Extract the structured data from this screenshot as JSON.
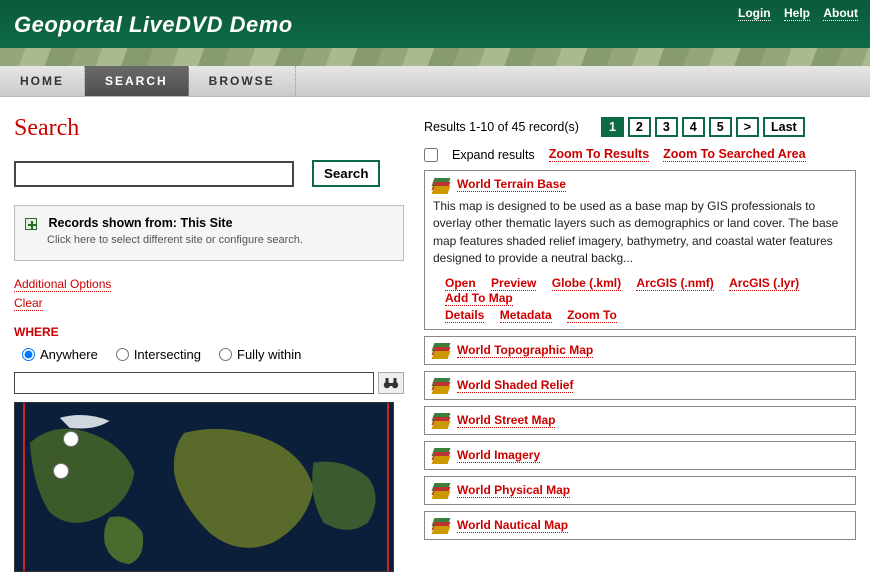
{
  "header": {
    "title": "Geoportal LiveDVD Demo",
    "links": {
      "login": "Login",
      "help": "Help",
      "about": "About"
    }
  },
  "nav": {
    "home": "HOME",
    "search": "SEARCH",
    "browse": "BROWSE"
  },
  "page_title": "Search",
  "search": {
    "button": "Search",
    "value": ""
  },
  "records_panel": {
    "title": "Records shown from: This Site",
    "subtitle": "Click here to select different site or configure search."
  },
  "options": {
    "additional": "Additional Options",
    "clear": "Clear",
    "where": "WHERE"
  },
  "radios": {
    "anywhere": "Anywhere",
    "intersecting": "Intersecting",
    "fully_within": "Fully within"
  },
  "locate": {
    "value": ""
  },
  "results_summary": "Results 1-10 of 45 record(s)",
  "pager": {
    "p1": "1",
    "p2": "2",
    "p3": "3",
    "p4": "4",
    "p5": "5",
    "next": ">",
    "last": "Last"
  },
  "expand": {
    "label": "Expand results",
    "zoom_results": "Zoom To Results",
    "zoom_searched": "Zoom To Searched Area"
  },
  "feature": {
    "title": "World Terrain Base",
    "desc": "This map is designed to be used as a base map by GIS professionals to overlay other thematic layers such as demographics or land cover. The base map features shaded relief imagery, bathymetry, and coastal water features designed to provide a neutral backg...",
    "actions": {
      "open": "Open",
      "preview": "Preview",
      "globe": "Globe (.kml)",
      "nmf": "ArcGIS (.nmf)",
      "lyr": "ArcGIS (.lyr)",
      "addmap": "Add To Map",
      "details": "Details",
      "metadata": "Metadata",
      "zoom": "Zoom To"
    }
  },
  "items": [
    {
      "title": "World Topographic Map"
    },
    {
      "title": "World Shaded Relief"
    },
    {
      "title": "World Street Map"
    },
    {
      "title": "World Imagery"
    },
    {
      "title": "World Physical Map"
    },
    {
      "title": "World Nautical Map"
    }
  ]
}
